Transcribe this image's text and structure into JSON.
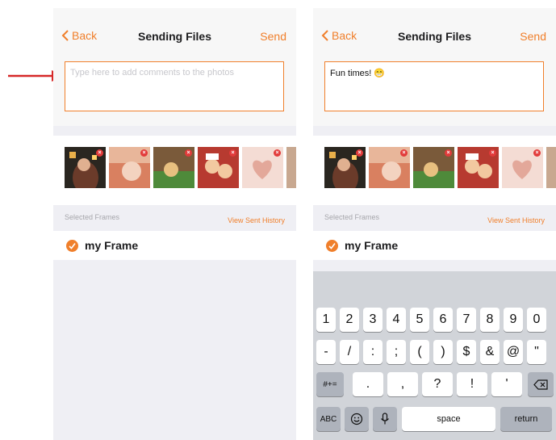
{
  "screen1": {
    "nav": {
      "back_label": "Back",
      "title": "Sending Files",
      "send_label": "Send"
    },
    "comment": {
      "placeholder": "Type here to add comments to the photos",
      "value": ""
    },
    "frames": {
      "section_label": "Selected Frames",
      "history_link": "View Sent History",
      "items": [
        "my Frame"
      ]
    }
  },
  "screen2": {
    "nav": {
      "back_label": "Back",
      "title": "Sending Files",
      "send_label": "Send"
    },
    "comment": {
      "value": "Fun times! 😁"
    },
    "frames": {
      "section_label": "Selected Frames",
      "history_link": "View Sent History",
      "items": [
        "my Frame"
      ]
    },
    "keyboard": {
      "row1": [
        "1",
        "2",
        "3",
        "4",
        "5",
        "6",
        "7",
        "8",
        "9",
        "0"
      ],
      "row2": [
        "-",
        "/",
        ":",
        ";",
        "(",
        ")",
        "$",
        "&",
        "@",
        "\""
      ],
      "row3": [
        "#+=",
        ".",
        ",",
        "?",
        "!",
        "'",
        "delete"
      ],
      "row4": [
        "ABC",
        "emoji",
        "mic",
        "space",
        "return"
      ]
    }
  },
  "colors": {
    "accent": "#f07f2b",
    "arrow": "#d62828"
  },
  "icons": {
    "remove": "remove-photo-icon",
    "check": "checkmark-icon",
    "back": "chevron-left-icon"
  }
}
